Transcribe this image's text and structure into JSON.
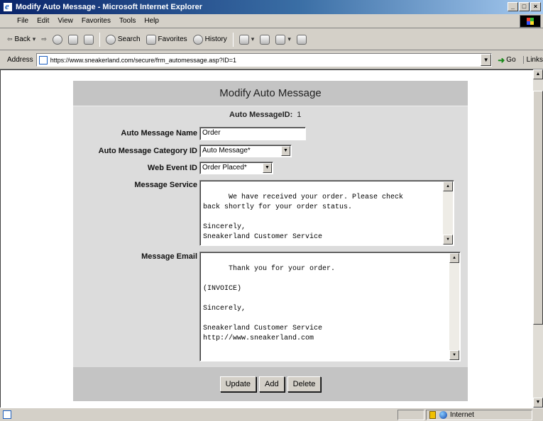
{
  "window": {
    "title": "Modify Auto Message - Microsoft Internet Explorer",
    "buttons": {
      "minimize": "_",
      "maximize": "□",
      "close": "×"
    }
  },
  "menu": [
    "File",
    "Edit",
    "View",
    "Favorites",
    "Tools",
    "Help"
  ],
  "toolbar": {
    "back": "Back",
    "search": "Search",
    "favorites": "Favorites",
    "history": "History"
  },
  "address": {
    "label": "Address",
    "url": "https://www.sneakerland.com/secure/frm_automessage.asp?ID=1",
    "go": "Go",
    "links": "Links"
  },
  "form": {
    "heading": "Modify Auto Message",
    "id_label": "Auto MessageID:",
    "id_value": "1",
    "name_label": "Auto Message Name",
    "name_value": "Order",
    "category_label": "Auto Message Category ID",
    "category_value": "Auto Message*",
    "web_event_label": "Web Event ID",
    "web_event_value": "Order Placed*",
    "service_label": "Message Service",
    "service_value": "We have received your order. Please check\nback shortly for your order status.\n\nSincerely,\nSneakerland Customer Service",
    "email_label": "Message Email",
    "email_value": "Thank you for your order.\n\n(INVOICE)\n\nSincerely,\n\nSneakerland Customer Service\nhttp://www.sneakerland.com",
    "buttons": {
      "update": "Update",
      "add": "Add",
      "delete": "Delete"
    }
  },
  "status": {
    "zone": "Internet"
  }
}
